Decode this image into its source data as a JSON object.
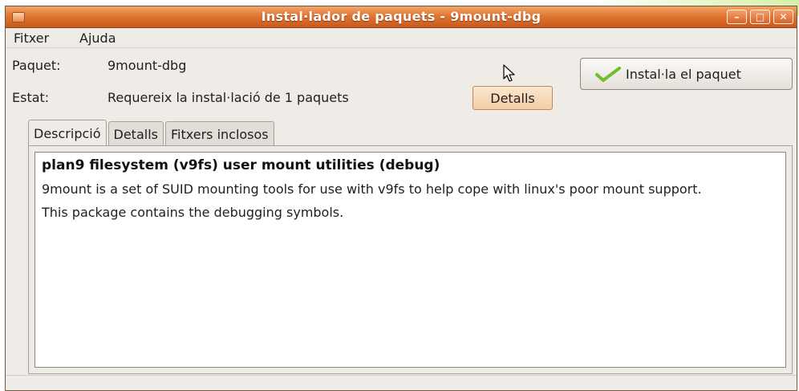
{
  "window": {
    "title": "Instal·lador de paquets - 9mount-dbg",
    "controls": [
      "minimize-icon",
      "maximize-icon",
      "close-icon"
    ]
  },
  "menu": {
    "file": "Fitxer",
    "help": "Ajuda"
  },
  "info": {
    "package_label": "Paquet:",
    "package_value": "9mount-dbg",
    "status_label": "Estat:",
    "status_value": "Requereix la instal·lació de 1 paquets"
  },
  "buttons": {
    "install": "Instal·la el paquet",
    "details": "Detalls"
  },
  "tabs": [
    {
      "label": "Descripció",
      "active": true
    },
    {
      "label": "Detalls",
      "active": false
    },
    {
      "label": "Fitxers inclosos",
      "active": false
    }
  ],
  "description": {
    "title": "plan9 filesystem (v9fs) user mount utilities (debug)",
    "para1": "9mount is a set of SUID mounting tools for use with v9fs to help cope with linux's poor mount support.",
    "para2": "This package contains the debugging symbols."
  },
  "colors": {
    "titlebar": "#e17631",
    "window_bg": "#efebe7",
    "accent_check": "#6fbf2e"
  }
}
